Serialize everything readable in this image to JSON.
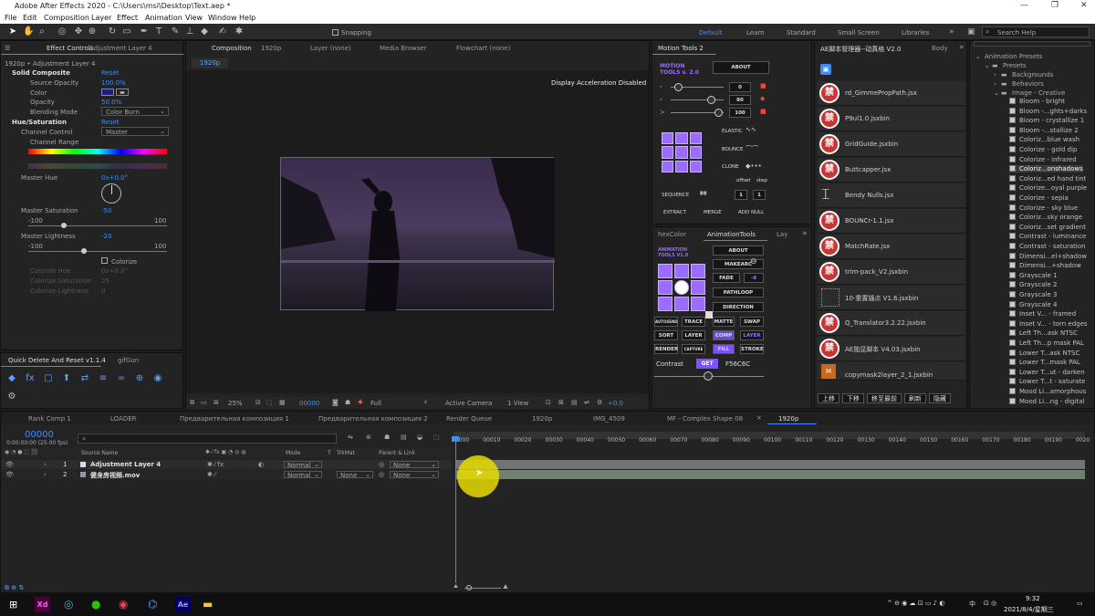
{
  "window": {
    "title": "Adobe After Effects 2020 - C:\\Users\\msi\\Desktop\\Text.aep *",
    "controls": [
      "—",
      "❐",
      "✕"
    ]
  },
  "menu": [
    "File",
    "Edit",
    "Composition",
    "Layer",
    "Effect",
    "Animation",
    "View",
    "Window",
    "Help"
  ],
  "toolbar": {
    "snapping": "Snapping",
    "workspaces": [
      "Default",
      "Learn",
      "Standard",
      "Small Screen",
      "Libraries"
    ],
    "search_placeholder": "Search Help"
  },
  "effect_controls": {
    "tab": "Effect Controls",
    "tab_layer": "Adjustment Layer 4",
    "header": "1920p • Adjustment Layer 4",
    "solid": {
      "name": "Solid Composite",
      "reset": "Reset",
      "source_opacity_label": "Source Opacity",
      "source_opacity": "100.0%",
      "color_label": "Color",
      "opacity_label": "Opacity",
      "opacity": "50.0%",
      "blending_label": "Blending Mode",
      "blending": "Color Burn"
    },
    "hue": {
      "name": "Hue/Saturation",
      "reset": "Reset",
      "channel_control_label": "Channel Control",
      "channel_control": "Master",
      "channel_range_label": "Channel Range",
      "master_hue_label": "Master Hue",
      "master_hue": "0x+0.0°",
      "master_sat_label": "Master Saturation",
      "master_sat": "-50",
      "sat_min": "-100",
      "sat_max": "100",
      "master_light_label": "Master Lightness",
      "master_light": "-20",
      "light_min": "-100",
      "light_max": "100",
      "colorize": "Colorize",
      "colorize_hue_label": "Colorize Hue",
      "colorize_hue": "0x+0.0°",
      "colorize_sat_label": "Colorize Saturation",
      "colorize_sat": "25",
      "colorize_light_label": "Colorize Lightness",
      "colorize_light": "0"
    }
  },
  "quick_delete": {
    "tab": "Quick Delete And Reset v1.1.4",
    "tab2": "gifGun"
  },
  "composition": {
    "tab": "Composition",
    "tab_name": "1920p",
    "other_tabs": [
      "Layer (none)",
      "Media Browser",
      "Flowchart (none)"
    ],
    "crumb": "1920p",
    "message": "Display Acceleration Disabled",
    "footer": {
      "zoom": "25%",
      "timecode": "00000",
      "resolution": "Full",
      "camera": "Active Camera",
      "view": "1 View",
      "exposure": "+0.0"
    }
  },
  "motion_tools": {
    "tab": "Motion Tools 2",
    "logo": "MOTION TOOLS v. 2.0",
    "about": "ABOUT",
    "v1": "0",
    "v2": "80",
    "v3": "100",
    "elastic": "ELASTIC",
    "bounce": "BOUNCE",
    "clone": "CLONE",
    "offset": "offset",
    "step": "step",
    "sequence": "SEQUENCE",
    "seq1": "1",
    "seq2": "1",
    "extract": "EXTRACT",
    "merge": "MERGE",
    "add_null": "ADD NULL"
  },
  "anim_tools": {
    "tabs": [
      "hexColor",
      "AnimationTools",
      "Lay"
    ],
    "logo": "ANIMATION TOOLS V1.0",
    "about": "ABOUT",
    "makearc": "MAKEARC",
    "fade": "FADE",
    "fade_val": "-8",
    "pathloop": "PATHLOOP",
    "direction": "DIRECTION",
    "buttons": [
      "AUTOSEND",
      "TRACE",
      "MATTE",
      "SWAP",
      "SORT",
      "LAYER",
      "COMP",
      "LAYER",
      "RENDER",
      "CAPTURE",
      "FILL",
      "STROKE"
    ],
    "contrast": "Contrast",
    "get": "GET",
    "hex": "F56C6C"
  },
  "script_manager": {
    "tab": "AE脚本管理器--动真格 V2.0",
    "tab2": "Body",
    "scripts": [
      "rd_GimmePropPath.jsx",
      "P9ul1.0.jsxbin",
      "GridGuide.jsxbin",
      "Buttcapper.jsx",
      "Bendy Nulls.jsx",
      "BOUNCr-1.1.jsx",
      "MatchRate.jsx",
      "trim-pack_V2.jsxbin",
      "10-重置锚点 V1.6.jsxbin",
      "Q_Translator3.2.22.jsxbin",
      "AE独显脚本 V4.03.jsxbin",
      "copymask2layer_2_1.jsxbin"
    ],
    "ban": "禁",
    "buttons": [
      "上移",
      "下移",
      "移至最前",
      "刷新",
      "隐藏"
    ]
  },
  "presets": {
    "search_placeholder": "",
    "root": "Animation Presets",
    "presets": "Presets",
    "folders": [
      "Backgrounds",
      "Behaviors",
      "Image - Creative"
    ],
    "items": [
      "Bloom - bright",
      "Bloom -...ghts+darks",
      "Bloom - crystallize 1",
      "Bloom -...stallize 2",
      "Coloriz...blue wash",
      "Colorize - gold dip",
      "Colorize - infrared",
      "Coloriz...onshadows",
      "Coloriz...ed hand tint",
      "Colorize...oyal purple",
      "Colorize - sepia",
      "Colorize - sky blue",
      "Coloriz...sky orange",
      "Coloriz...set gradient",
      "Contrast - luminance",
      "Contrast - saturation",
      "Dimensi...el+shadow",
      "Dimensi...+shadow",
      "Grayscale 1",
      "Grayscale 2",
      "Grayscale 3",
      "Grayscale 4",
      "Inset V... - framed",
      "Inset V... - torn edges",
      "Left Th...ask NTSC",
      "Left Th...p mask PAL",
      "Lower T...ask NTSC",
      "Lower T...mask PAL",
      "Lower T...ut - darken",
      "Lower T...t - saturate",
      "Mood Li...amorphous",
      "Mood Li...ng - digital"
    ],
    "selected_index": 7
  },
  "timeline": {
    "tabs": [
      "Rank Comp 1",
      "LOADER",
      "Предварительная композиция 1",
      "Предварительная композиция 2",
      "Render Queue",
      "1920p",
      "IMG_4509",
      "MF - Complex Shape 08",
      "1920p"
    ],
    "timecode": "00000",
    "timecode_sub": "0:00:00:00 (25.00 fps)",
    "columns": {
      "source": "Source Name",
      "mode": "Mode",
      "t": "T",
      "trkmat": "TrkMat",
      "parent": "Parent & Link"
    },
    "layers": [
      {
        "num": "1",
        "name": "Adjustment Layer 4",
        "mode": "Normal",
        "trkmat": "",
        "parent": "None"
      },
      {
        "num": "2",
        "name": "健身房视频.mov",
        "mode": "Normal",
        "trkmat": "None",
        "parent": "None"
      }
    ],
    "ruler": [
      "00000",
      "00010",
      "00020",
      "00030",
      "00040",
      "00050",
      "00060",
      "00070",
      "00080",
      "00090",
      "00100",
      "00110",
      "00120",
      "00130",
      "00140",
      "00150",
      "00160",
      "00170",
      "00180",
      "00190",
      "0020"
    ]
  },
  "taskbar": {
    "time": "9:32",
    "date": "2021/8/4/星期三",
    "ime": "中",
    "apps": [
      "Xd",
      "Ae"
    ]
  },
  "colors": {
    "accent": "#3d8bff",
    "purple": "#9b6cff",
    "ban_red": "#cc3333"
  }
}
